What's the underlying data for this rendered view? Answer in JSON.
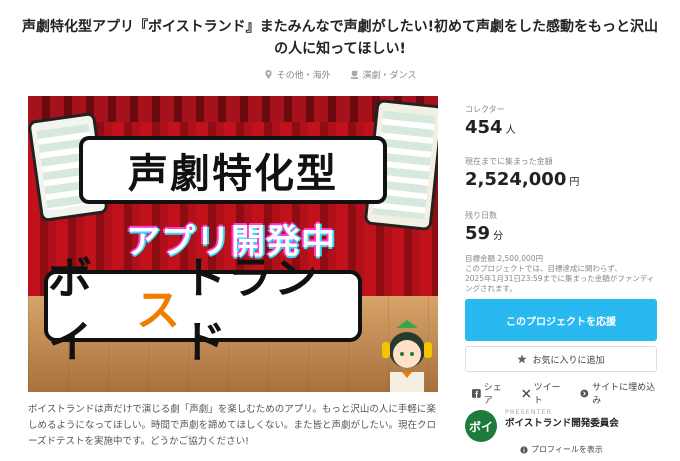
{
  "project": {
    "title": "声劇特化型アプリ『ボイストランド』またみんなで声劇がしたい!初めて声劇をした感動をもっと沢山の人に知ってほしい!",
    "location": "その他・海外",
    "category": "演劇・ダンス"
  },
  "hero": {
    "line1": "声劇特化型",
    "line2": "アプリ開発中",
    "logo_part1": "ボイ",
    "logo_part2": "ス",
    "logo_part3": "トランド"
  },
  "description": "ボイストランドは声だけで演じる劇「声劇」を楽しむためのアプリ。もっと沢山の人に手軽に楽しめるようになってほしい。時間で声劇を諦めてほしくない。また皆と声劇がしたい。現在クローズドテストを実施中です。どうかご協力ください!",
  "stats": {
    "collectors_label": "コレクター",
    "collectors_value": "454",
    "collectors_unit": "人",
    "raised_label": "現在までに集まった金額",
    "raised_value": "2,524,000",
    "raised_unit": "円",
    "days_label": "残り日数",
    "days_value": "59",
    "days_unit": "分",
    "goal_text": "目標金額 2,500,000円",
    "note_line1": "このプロジェクトでは、目標達成に関わらず、",
    "note_line2": "2025年1月31日23:59までに集まった金額がファンディングされます。"
  },
  "actions": {
    "back_button": "このプロジェクトを応援",
    "favorite_button": "お気に入りに追加",
    "share_label": "シェア",
    "tweet_label": "ツイート",
    "embed_label": "サイトに埋め込み"
  },
  "presenter": {
    "label": "PRESENTER",
    "name": "ボイストランド開発委員会",
    "profile_link": "プロフィールを表示",
    "avatar_text": "ボイ"
  },
  "colors": {
    "accent": "#2ab8f0",
    "curtain": "#c1121c",
    "logo_orange": "#f07c00"
  }
}
